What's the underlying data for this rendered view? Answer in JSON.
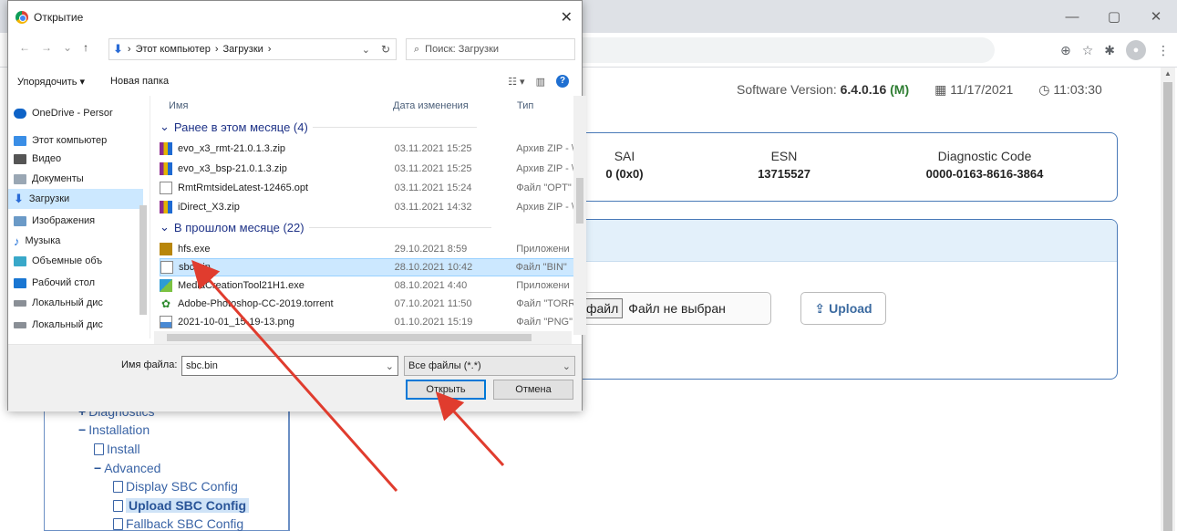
{
  "colors": {
    "accent": "#0078d7",
    "link": "#3a64a6",
    "card_border": "#4a7ab8",
    "arrow": "#e03c2e"
  },
  "browser": {
    "window_controls": [
      "—",
      "▢",
      "✕"
    ]
  },
  "page": {
    "header": {
      "sw_label": "Software Version:",
      "sw_value": "6.4.0.16",
      "sw_status": "(M)",
      "date": "11/17/2021",
      "time": "11:03:30"
    },
    "info": {
      "sai_label": "SAI",
      "sai_value": "0 (0x0)",
      "esn_label": "ESN",
      "esn_value": "13715527",
      "diag_label": "Diagnostic Code",
      "diag_value": "0000-0163-8616-3864"
    },
    "upload": {
      "choose_label": "файл",
      "no_file": "Файл не выбран",
      "upload_label": "Upload"
    },
    "tree": {
      "diagnostics": "Diagnostics",
      "installation": "Installation",
      "install": "Install",
      "advanced": "Advanced",
      "display_sbc": "Display SBC Config",
      "upload_sbc": "Upload SBC Config",
      "fallback_sbc": "Fallback SBC Config"
    }
  },
  "dialog": {
    "title": "Открытие",
    "path": [
      "Этот компьютер",
      "Загрузки"
    ],
    "search_placeholder": "Поиск: Загрузки",
    "toolbar": {
      "organize": "Упорядочить ▾",
      "new_folder": "Новая папка"
    },
    "nav_items": [
      {
        "label": "OneDrive - Persor",
        "icon": "cloud-icon"
      },
      {
        "label": "Этот компьютер",
        "icon": "computer-icon"
      },
      {
        "label": "Видео",
        "icon": "video-icon"
      },
      {
        "label": "Документы",
        "icon": "documents-icon"
      },
      {
        "label": "Загрузки",
        "icon": "downloads-icon"
      },
      {
        "label": "Изображения",
        "icon": "pictures-icon"
      },
      {
        "label": "Музыка",
        "icon": "music-icon"
      },
      {
        "label": "Объемные объ",
        "icon": "3d-objects-icon"
      },
      {
        "label": "Рабочий стол",
        "icon": "desktop-icon"
      },
      {
        "label": "Локальный дис",
        "icon": "drive-icon"
      },
      {
        "label": "Локальный дис",
        "icon": "drive-icon"
      }
    ],
    "columns": {
      "name": "Имя",
      "date": "Дата изменения",
      "type": "Тип"
    },
    "groups": [
      {
        "title": "Ранее в этом месяце (4)",
        "files": [
          {
            "name": "evo_x3_rmt-21.0.1.3.zip",
            "date": "03.11.2021 15:25",
            "type": "Архив ZIP - \\",
            "icon": "zip-icon"
          },
          {
            "name": "evo_x3_bsp-21.0.1.3.zip",
            "date": "03.11.2021 15:25",
            "type": "Архив ZIP - \\",
            "icon": "zip-icon"
          },
          {
            "name": "RmtRmtsideLatest-12465.opt",
            "date": "03.11.2021 15:24",
            "type": "Файл \"OPT\"",
            "icon": "file-icon"
          },
          {
            "name": "iDirect_X3.zip",
            "date": "03.11.2021 14:32",
            "type": "Архив ZIP - \\",
            "icon": "zip-icon"
          }
        ]
      },
      {
        "title": "В прошлом месяце (22)",
        "files": [
          {
            "name": "hfs.exe",
            "date": "29.10.2021 8:59",
            "type": "Приложени",
            "icon": "exe-icon"
          },
          {
            "name": "sbc.bin",
            "date": "28.10.2021 10:42",
            "type": "Файл \"BIN\"",
            "icon": "file-icon"
          },
          {
            "name": "MediaCreationTool21H1.exe",
            "date": "08.10.2021 4:40",
            "type": "Приложени",
            "icon": "exe-icon"
          },
          {
            "name": "Adobe-Photoshop-CC-2019.torrent",
            "date": "07.10.2021 11:50",
            "type": "Файл \"TORRE",
            "icon": "torrent-icon"
          },
          {
            "name": "2021-10-01_15-19-13.png",
            "date": "01.10.2021 15:19",
            "type": "Файл \"PNG\"",
            "icon": "image-icon"
          }
        ]
      }
    ],
    "filename_label": "Имя файла:",
    "filename_value": "sbc.bin",
    "filetype": "Все файлы (*.*)",
    "open_label": "Открыть",
    "cancel_label": "Отмена"
  }
}
